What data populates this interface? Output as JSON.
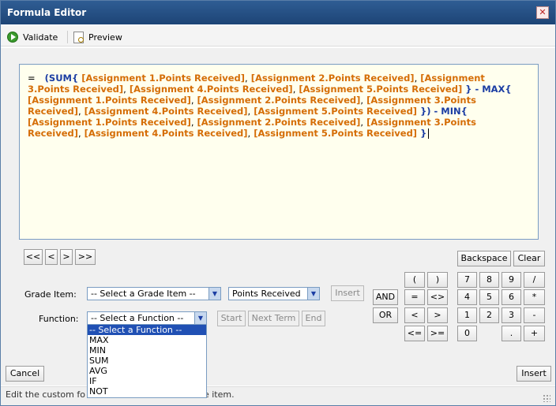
{
  "window": {
    "title": "Formula Editor",
    "close_glyph": "✕"
  },
  "toolbar": {
    "validate_label": "Validate",
    "preview_label": "Preview"
  },
  "formula": {
    "eq": "=",
    "sum_open": "(SUM{",
    "max_open": "} - MAX{",
    "min_open": "}) - MIN{",
    "end": "}",
    "sep": ",",
    "refs": {
      "a1": "[Assignment 1.Points Received]",
      "a2": "[Assignment 2.Points Received]",
      "a3": "[Assignment 3.Points Received]",
      "a4": "[Assignment 4.Points Received]",
      "a5": "[Assignment 5.Points Received]"
    }
  },
  "nav": {
    "first": "<<",
    "prev": "<",
    "next": ">",
    "last": ">>"
  },
  "grade_item": {
    "label": "Grade Item:",
    "select_value": "-- Select a Grade Item --",
    "property_value": "Points Received",
    "insert_label": "Insert"
  },
  "function": {
    "label": "Function:",
    "select_value": "-- Select a Function --",
    "start_label": "Start",
    "next_term_label": "Next Term",
    "end_label": "End",
    "options": [
      "-- Select a Function --",
      "MAX",
      "MIN",
      "SUM",
      "AVG",
      "IF",
      "NOT"
    ]
  },
  "logic": {
    "and": "AND",
    "or": "OR"
  },
  "keypad": {
    "backspace": "Backspace",
    "clear": "Clear",
    "paren_open": "(",
    "paren_close": ")",
    "eq": "=",
    "neq": "<>",
    "lt": "<",
    "gt": ">",
    "lte": "<=",
    "gte": ">=",
    "d7": "7",
    "d8": "8",
    "d9": "9",
    "div": "/",
    "d4": "4",
    "d5": "5",
    "d6": "6",
    "mul": "*",
    "d1": "1",
    "d2": "2",
    "d3": "3",
    "sub": "-",
    "d0": "0",
    "dot": ".",
    "add": "+"
  },
  "footer": {
    "cancel_label": "Cancel",
    "insert_label": "Insert",
    "status_text": "Edit the custom fo",
    "status_text_tail": "e item."
  }
}
